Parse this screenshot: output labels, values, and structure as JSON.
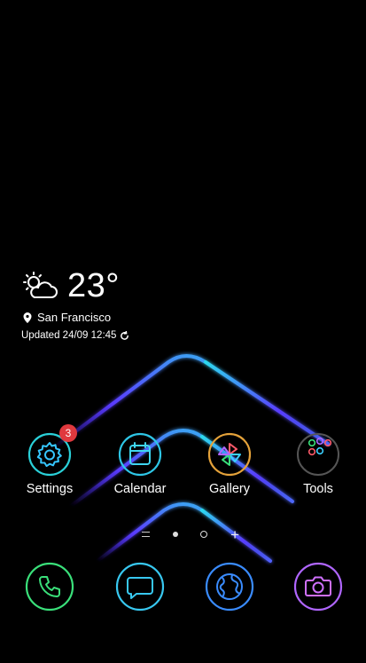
{
  "weather": {
    "temperature": "23°",
    "location": "San Francisco",
    "updated": "Updated 24/09 12:45",
    "icon": "partly-cloudy-icon"
  },
  "apps": [
    {
      "label": "Settings",
      "icon": "gear-icon",
      "badge": "3"
    },
    {
      "label": "Calendar",
      "icon": "calendar-icon"
    },
    {
      "label": "Gallery",
      "icon": "pinwheel-icon"
    },
    {
      "label": "Tools",
      "icon": "folder-icon"
    }
  ],
  "dock": [
    {
      "icon": "phone-icon"
    },
    {
      "icon": "message-icon"
    },
    {
      "icon": "browser-icon"
    },
    {
      "icon": "camera-icon"
    }
  ],
  "pager": {
    "current_page": 1,
    "page_count": 1
  },
  "colors": {
    "background": "#000000",
    "neon_cyan": "#29d6e8",
    "neon_violet": "#6a44ff",
    "badge": "#e0393e"
  }
}
